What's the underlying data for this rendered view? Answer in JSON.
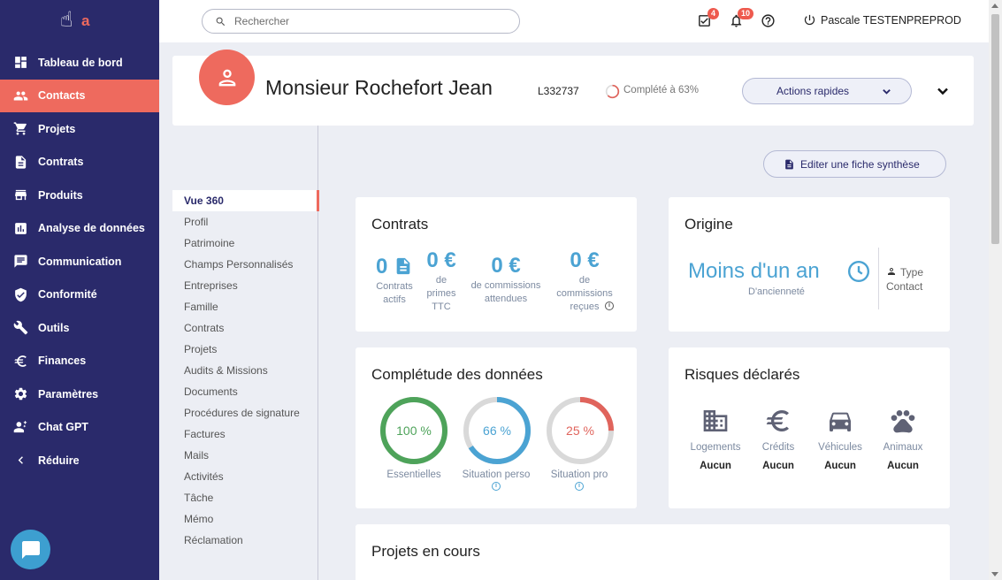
{
  "sidebar": {
    "items": [
      {
        "label": "Tableau de bord",
        "icon": "dashboard-icon"
      },
      {
        "label": "Contacts",
        "icon": "people-icon",
        "active": true
      },
      {
        "label": "Projets",
        "icon": "cart-icon"
      },
      {
        "label": "Contrats",
        "icon": "document-icon"
      },
      {
        "label": "Produits",
        "icon": "store-icon"
      },
      {
        "label": "Analyse de données",
        "icon": "analytics-icon"
      },
      {
        "label": "Communication",
        "icon": "message-icon"
      },
      {
        "label": "Conformité",
        "icon": "shield-check-icon"
      },
      {
        "label": "Outils",
        "icon": "tools-icon"
      },
      {
        "label": "Finances",
        "icon": "euro-icon"
      },
      {
        "label": "Paramètres",
        "icon": "gear-icon"
      },
      {
        "label": "Chat GPT",
        "icon": "sparkle-person-icon"
      },
      {
        "label": "Réduire",
        "icon": "chevron-left-icon"
      }
    ]
  },
  "topbar": {
    "search_placeholder": "Rechercher",
    "tasks_badge": "4",
    "notifications_badge": "10",
    "user_name": "Pascale TESTENPREPROD"
  },
  "contact": {
    "name": "Monsieur Rochefort Jean",
    "ref": "L332737",
    "completion_text": "Complété à 63%",
    "completion_fraction": 0.63,
    "actions_label": "Actions rapides",
    "edit_label": "Editer une fiche synthèse"
  },
  "subnav": {
    "items": [
      {
        "label": "Vue 360",
        "active": true
      },
      {
        "label": "Profil"
      },
      {
        "label": "Patrimoine"
      },
      {
        "label": "Champs Personnalisés"
      },
      {
        "label": "Entreprises"
      },
      {
        "label": "Famille"
      },
      {
        "label": "Contrats"
      },
      {
        "label": "Projets"
      },
      {
        "label": "Audits & Missions"
      },
      {
        "label": "Documents"
      },
      {
        "label": "Procédures de signature"
      },
      {
        "label": "Factures"
      },
      {
        "label": "Mails"
      },
      {
        "label": "Activités"
      },
      {
        "label": "Tâche"
      },
      {
        "label": "Mémo"
      },
      {
        "label": "Réclamation"
      }
    ]
  },
  "contracts": {
    "title": "Contrats",
    "actifs_value": "0",
    "actifs_label": "Contrats actifs",
    "primes_value": "0 €",
    "primes_label": "de primes TTC",
    "attendues_value": "0 €",
    "attendues_label": "de commissions attendues",
    "recues_value": "0 €",
    "recues_label": "de commissions reçues"
  },
  "origin": {
    "title": "Origine",
    "value": "Moins d'un an",
    "sub": "D'ancienneté",
    "type_label": "Type Contact"
  },
  "completude": {
    "title": "Complétude des données",
    "items": [
      {
        "label": "Essentielles",
        "percent_text": "100 %",
        "fraction": 1.0,
        "color": "#4ea35a"
      },
      {
        "label": "Situation perso",
        "percent_text": "66 %",
        "fraction": 0.66,
        "color": "#4ba3d3"
      },
      {
        "label": "Situation pro",
        "percent_text": "25 %",
        "fraction": 0.25,
        "color": "#e0645c"
      }
    ]
  },
  "risques": {
    "title": "Risques déclarés",
    "items": [
      {
        "label": "Logements",
        "value": "Aucun",
        "icon": "building-icon"
      },
      {
        "label": "Crédits",
        "value": "Aucun",
        "icon": "euro-icon"
      },
      {
        "label": "Véhicules",
        "value": "Aucun",
        "icon": "car-icon"
      },
      {
        "label": "Animaux",
        "value": "Aucun",
        "icon": "paw-icon"
      }
    ]
  },
  "projets": {
    "title": "Projets en cours"
  },
  "colors": {
    "sidebar_bg": "#2a2a6b",
    "accent": "#ee6a5e",
    "stat_blue": "#4ba3d3"
  }
}
